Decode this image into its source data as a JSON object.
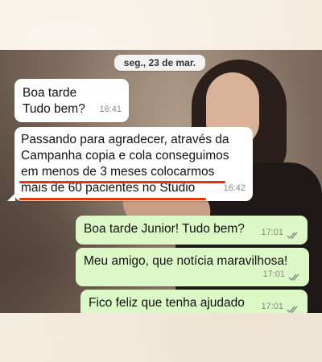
{
  "conversation": {
    "date_label": "seg., 23 de mar.",
    "messages": [
      {
        "direction": "incoming",
        "text": "Boa tarde\nTudo bem?",
        "time": "16:41"
      },
      {
        "direction": "incoming",
        "text": "Passando para agradecer, através da\nCampanha copia e cola conseguimos\nem menos de 3 meses colocarmos\nmais de 60 pacientes no Studio",
        "time": "16:42"
      },
      {
        "direction": "outgoing",
        "text": "Boa tarde Junior! Tudo bem?",
        "time": "17:01",
        "status": "read"
      },
      {
        "direction": "outgoing",
        "text": "Meu amigo, que notícia maravilhosa!",
        "time": "17:01",
        "status": "read"
      },
      {
        "direction": "outgoing",
        "text": "Fico feliz que tenha ajudado",
        "time": "17:01",
        "status": "read"
      }
    ]
  },
  "colors": {
    "incoming_bubble": "#ffffff",
    "outgoing_bubble": "#dcf8c6",
    "highlight_underline": "#e5360a",
    "read_ticks": "#8a8a8a"
  }
}
